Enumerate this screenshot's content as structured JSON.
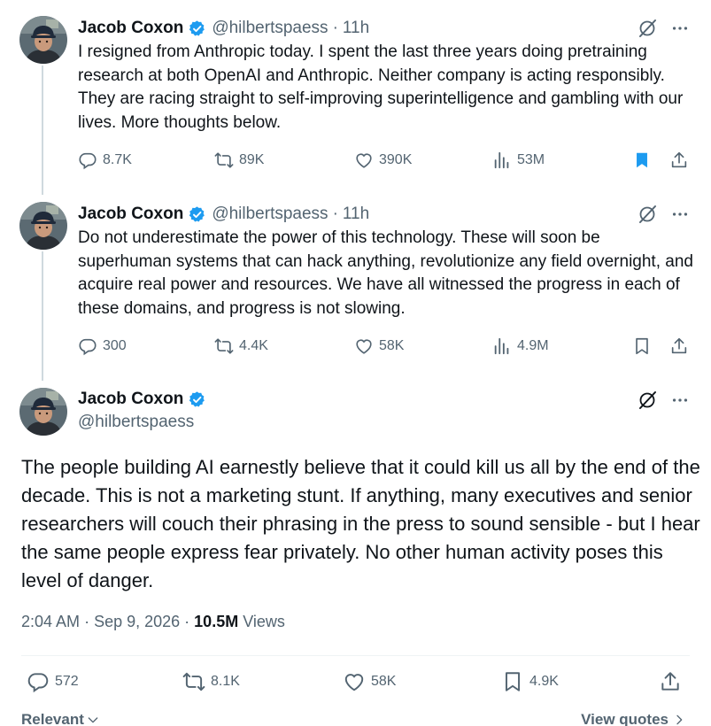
{
  "author": {
    "name": "Jacob Coxon",
    "handle": "@hilbertspaess",
    "time": "11h"
  },
  "tweets": [
    {
      "text": "I resigned from Anthropic today. I spent the last three years doing pretraining research at both OpenAI and Anthropic. Neither company is acting responsibly. They are racing straight to self-improving superintelligence and gambling with our lives. More thoughts below.",
      "replies": "8.7K",
      "reposts": "89K",
      "likes": "390K",
      "views": "53M",
      "bookmarked": true
    },
    {
      "text": "Do not underestimate the power of this technology. These will soon be superhuman systems that can hack anything, revolutionize any field overnight, and acquire real power and resources. We have all witnessed the progress in each of these domains, and progress is not slowing.",
      "replies": "300",
      "reposts": "4.4K",
      "likes": "58K",
      "views": "4.9M",
      "bookmarked": false
    }
  ],
  "main_tweet": {
    "name": "Jacob Coxon",
    "handle": "@hilbertspaess",
    "text": "The people building AI earnestly believe that it could kill us all by the end of the decade. This is not a marketing stunt. If anything, many executives and senior researchers will couch their phrasing in the press to sound sensible - but I hear the same people express fear privately. No other human activity poses this level of danger.",
    "time": "2:04 AM",
    "date": "Sep 9, 2026",
    "views_count": "10.5M",
    "views_label": "Views",
    "replies": "572",
    "reposts": "8.1K",
    "likes": "58K",
    "bookmarks": "4.9K"
  },
  "footer": {
    "sort_label": "Relevant",
    "view_quotes": "View quotes"
  },
  "colors": {
    "accent": "#1d9bf0",
    "text": "#0f1419",
    "muted": "#536471"
  },
  "icons": [
    "verified-badge-icon",
    "grok-icon",
    "more-icon",
    "reply-icon",
    "repost-icon",
    "like-icon",
    "views-icon",
    "bookmark-icon",
    "share-icon",
    "chevron-down-icon",
    "chevron-right-icon"
  ]
}
